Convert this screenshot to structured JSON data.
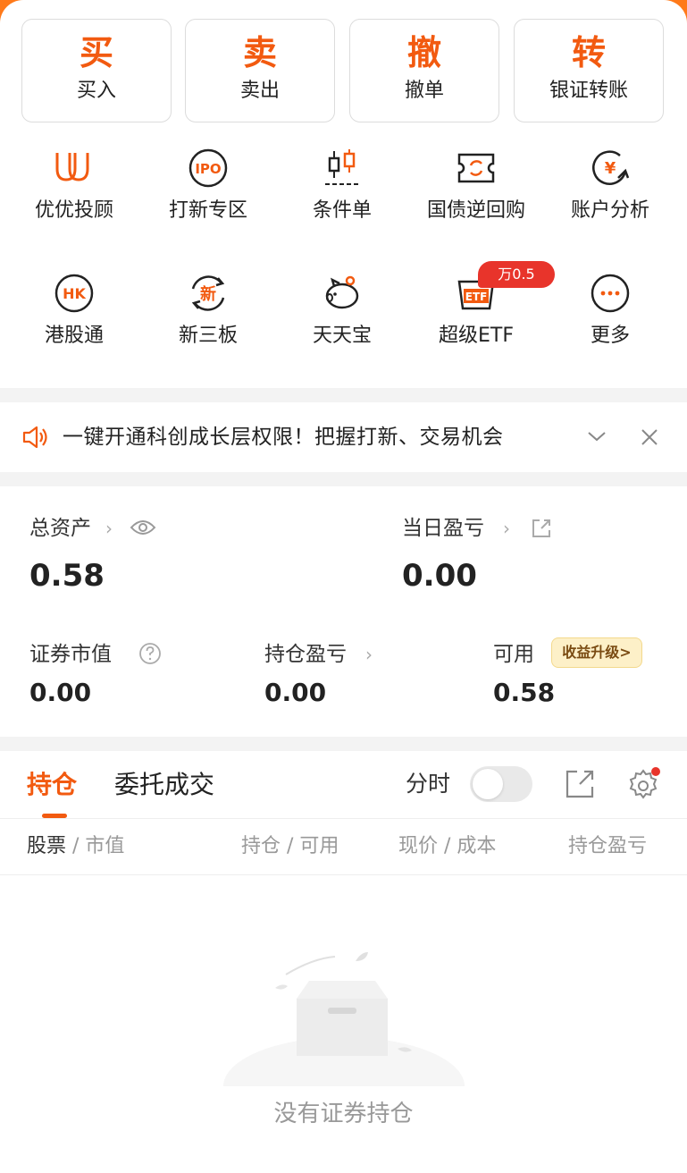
{
  "colors": {
    "accent": "#f25a10",
    "header_orange": "#ff7a1a",
    "badge_red": "#e8342b"
  },
  "quick_actions": [
    {
      "big": "买",
      "label": "买入"
    },
    {
      "big": "卖",
      "label": "卖出"
    },
    {
      "big": "撤",
      "label": "撤单"
    },
    {
      "big": "转",
      "label": "银证转账"
    }
  ],
  "services": [
    {
      "label": "优优投顾",
      "icon": "uu-advisor-icon"
    },
    {
      "label": "打新专区",
      "icon": "ipo-icon"
    },
    {
      "label": "条件单",
      "icon": "conditional-order-icon"
    },
    {
      "label": "国债逆回购",
      "icon": "reverse-repo-icon"
    },
    {
      "label": "账户分析",
      "icon": "account-analysis-icon"
    },
    {
      "label": "港股通",
      "icon": "hk-connect-icon"
    },
    {
      "label": "新三板",
      "icon": "new-otc-icon"
    },
    {
      "label": "天天宝",
      "icon": "piggy-bank-icon"
    },
    {
      "label": "超级ETF",
      "icon": "etf-icon"
    },
    {
      "label": "更多",
      "icon": "more-icon"
    }
  ],
  "service_icon_text": {
    "ipo": "IPO",
    "hk": "HK",
    "new": "新",
    "yen": "¥",
    "etf": "ETF"
  },
  "etf_badge": "万0.5",
  "notice": {
    "text": "一键开通科创成长层权限！把握打新、交易机会"
  },
  "assets": {
    "total_label": "总资产",
    "total_value": "0.58",
    "daily_pl_label": "当日盈亏",
    "daily_pl_value": "0.00",
    "market_value_label": "证券市值",
    "market_value": "0.00",
    "position_pl_label": "持仓盈亏",
    "position_pl_value": "0.00",
    "available_label": "可用",
    "available_value": "0.58",
    "upgrade_label": "收益升级>"
  },
  "holdings": {
    "tabs": [
      "持仓",
      "委托成交"
    ],
    "toggle_label": "分时",
    "columns": [
      {
        "main": "股票",
        "sub": "市值"
      },
      {
        "main": "持仓",
        "sub": "可用"
      },
      {
        "main": "现价",
        "sub": "成本"
      },
      {
        "main": "持仓盈亏",
        "sub": ""
      }
    ],
    "empty_text": "没有证券持仓"
  }
}
